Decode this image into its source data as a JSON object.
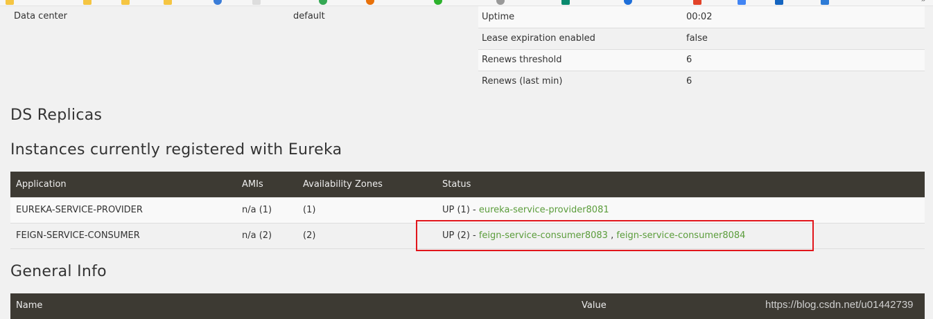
{
  "info_left": {
    "label": "Data center",
    "value": "default"
  },
  "info_right": [
    {
      "key": "Uptime",
      "value": "00:02"
    },
    {
      "key": "Lease expiration enabled",
      "value": "false"
    },
    {
      "key": "Renews threshold",
      "value": "6"
    },
    {
      "key": "Renews (last min)",
      "value": "6"
    }
  ],
  "headings": {
    "ds_replicas": "DS Replicas",
    "instances": "Instances currently registered with Eureka",
    "general_info": "General Info"
  },
  "instances_table": {
    "headers": [
      "Application",
      "AMIs",
      "Availability Zones",
      "Status"
    ],
    "rows": [
      {
        "application": "EUREKA-SERVICE-PROVIDER",
        "amis": "n/a (1)",
        "zones": "(1)",
        "status_prefix": "UP (1) - ",
        "links": [
          "eureka-service-provider8081"
        ]
      },
      {
        "application": "FEIGN-SERVICE-CONSUMER",
        "amis": "n/a (2)",
        "zones": "(2)",
        "status_prefix": "UP (2) - ",
        "links": [
          "feign-service-consumer8083",
          "feign-service-consumer8084"
        ],
        "separator": " , "
      }
    ]
  },
  "general_info_table": {
    "headers": [
      "Name",
      "Value"
    ]
  },
  "watermark": "https://blog.csdn.net/u01442739",
  "colors": {
    "header_bg": "#3d3a33",
    "link": "#5a9c3a",
    "highlight": "#e1151b",
    "page_bg": "#f1f1f1"
  }
}
